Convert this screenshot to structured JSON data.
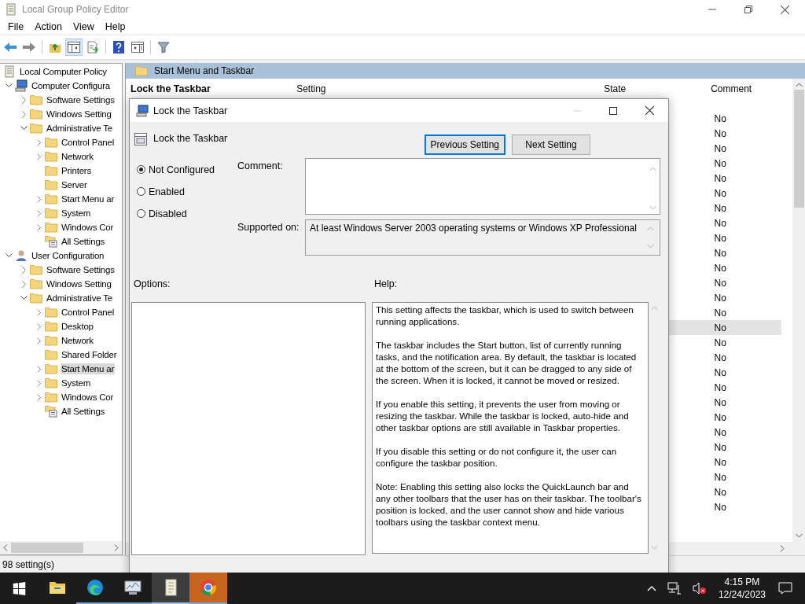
{
  "window": {
    "title": "Local Group Policy Editor"
  },
  "menu": [
    "File",
    "Action",
    "View",
    "Help"
  ],
  "toolbar": [
    {
      "kind": "back",
      "on": false
    },
    {
      "kind": "forward",
      "on": false
    },
    {
      "kind": "sep"
    },
    {
      "kind": "up",
      "on": false
    },
    {
      "kind": "tree",
      "on": true
    },
    {
      "kind": "export",
      "on": false
    },
    {
      "kind": "sep"
    },
    {
      "kind": "help",
      "on": false
    },
    {
      "kind": "view",
      "on": false
    },
    {
      "kind": "sep"
    },
    {
      "kind": "filter",
      "on": false
    }
  ],
  "tree": {
    "label": "Local Computer Policy",
    "kind": "doc",
    "selected": false,
    "children": [
      {
        "label": "Computer Configura",
        "kind": "computer",
        "expanded": true,
        "selected": false,
        "children": [
          {
            "label": "Software Settings",
            "kind": "folder",
            "expanded": false,
            "selected": false
          },
          {
            "label": "Windows Setting",
            "kind": "folder",
            "expanded": false,
            "selected": false
          },
          {
            "label": "Administrative Te",
            "kind": "folder",
            "expanded": true,
            "selected": false,
            "children": [
              {
                "label": "Control Panel",
                "kind": "folder",
                "expanded": false,
                "selected": false
              },
              {
                "label": "Network",
                "kind": "folder",
                "expanded": false,
                "selected": false
              },
              {
                "label": "Printers",
                "kind": "folder",
                "selected": false
              },
              {
                "label": "Server",
                "kind": "folder",
                "selected": false
              },
              {
                "label": "Start Menu ar",
                "kind": "folder",
                "expanded": false,
                "selected": false
              },
              {
                "label": "System",
                "kind": "folder",
                "expanded": false,
                "selected": false
              },
              {
                "label": "Windows Cor",
                "kind": "folder",
                "expanded": false,
                "selected": false
              },
              {
                "label": "All Settings",
                "kind": "settings",
                "selected": false
              }
            ]
          }
        ]
      },
      {
        "label": "User Configuration",
        "kind": "user",
        "expanded": true,
        "selected": false,
        "children": [
          {
            "label": "Software Settings",
            "kind": "folder",
            "expanded": false,
            "selected": false
          },
          {
            "label": "Windows Setting",
            "kind": "folder",
            "expanded": false,
            "selected": false
          },
          {
            "label": "Administrative Te",
            "kind": "folder",
            "expanded": true,
            "selected": false,
            "children": [
              {
                "label": "Control Panel",
                "kind": "folder",
                "expanded": false,
                "selected": false
              },
              {
                "label": "Desktop",
                "kind": "folder",
                "expanded": false,
                "selected": false
              },
              {
                "label": "Network",
                "kind": "folder",
                "expanded": false,
                "selected": false
              },
              {
                "label": "Shared Folder",
                "kind": "folder",
                "selected": false
              },
              {
                "label": "Start Menu ar",
                "kind": "folder",
                "expanded": false,
                "selected": true
              },
              {
                "label": "System",
                "kind": "folder",
                "expanded": false,
                "selected": false
              },
              {
                "label": "Windows Cor",
                "kind": "folder",
                "expanded": false,
                "selected": false
              },
              {
                "label": "All Settings",
                "kind": "settings",
                "selected": false
              }
            ]
          }
        ]
      }
    ]
  },
  "content": {
    "folder": "Start Menu and Taskbar",
    "description_title": "Lock the Taskbar",
    "columns": [
      "Setting",
      "State",
      "Comment"
    ],
    "rows": [
      {
        "comment": "No",
        "selected": false
      },
      {
        "comment": "No",
        "selected": false
      },
      {
        "comment": "No",
        "selected": false
      },
      {
        "comment": "No",
        "selected": false
      },
      {
        "comment": "No",
        "selected": false
      },
      {
        "comment": "No",
        "selected": false
      },
      {
        "comment": "No",
        "selected": false
      },
      {
        "comment": "No",
        "selected": false
      },
      {
        "comment": "No",
        "selected": false
      },
      {
        "comment": "No",
        "selected": false
      },
      {
        "comment": "No",
        "selected": false
      },
      {
        "comment": "No",
        "selected": false
      },
      {
        "comment": "No",
        "selected": false
      },
      {
        "comment": "No",
        "selected": false
      },
      {
        "comment": "No",
        "selected": true
      },
      {
        "comment": "No",
        "selected": false
      },
      {
        "comment": "No",
        "selected": false
      },
      {
        "comment": "No",
        "selected": false
      },
      {
        "comment": "No",
        "selected": false
      },
      {
        "comment": "No",
        "selected": false
      },
      {
        "comment": "No",
        "selected": false
      },
      {
        "comment": "No",
        "selected": false
      },
      {
        "comment": "No",
        "selected": false
      },
      {
        "comment": "No",
        "selected": false
      },
      {
        "comment": "No",
        "selected": false
      },
      {
        "comment": "No",
        "selected": false
      },
      {
        "comment": "No",
        "selected": false
      }
    ]
  },
  "status_bar": "98 setting(s)",
  "dialog": {
    "title": "Lock the Taskbar",
    "setting_name": "Lock the Taskbar",
    "buttons": [
      {
        "label": "Previous Setting",
        "focused": true
      },
      {
        "label": "Next Setting",
        "focused": false
      }
    ],
    "options": [
      {
        "label": "Not Configured",
        "selected": true
      },
      {
        "label": "Enabled",
        "selected": false
      },
      {
        "label": "Disabled",
        "selected": false
      }
    ],
    "comment_label": "Comment:",
    "supported_label": "Supported on:",
    "supported_on": "At least Windows Server 2003 operating systems or Windows XP Professional",
    "options_label": "Options:",
    "help_label": "Help:",
    "help": [
      "This setting affects the taskbar, which is used to switch between running applications.",
      "The taskbar includes the Start button, list of currently running tasks, and the notification area. By default, the taskbar is located at the bottom of the screen, but it can be dragged to any side of the screen. When it is locked, it cannot be moved or resized.",
      "If you enable this setting, it prevents the user from moving or resizing the taskbar. While the taskbar is locked, auto-hide and other taskbar options are still available in Taskbar properties.",
      "If you disable this setting or do not configure it, the user can configure the taskbar position.",
      "Note: Enabling this setting also locks the QuickLaunch bar and any other toolbars that the user has on their taskbar. The toolbar's position is locked, and the user cannot show and hide various toolbars using the taskbar context menu."
    ]
  },
  "taskbar": {
    "apps": [
      {
        "kind": "explorer",
        "running": false,
        "selected": false,
        "flashing": false
      },
      {
        "kind": "edge",
        "running": true,
        "selected": false,
        "flashing": false
      },
      {
        "kind": "monitor",
        "running": true,
        "selected": false,
        "flashing": false
      },
      {
        "kind": "policy",
        "running": true,
        "selected": true,
        "flashing": false
      },
      {
        "kind": "chrome",
        "running": true,
        "selected": false,
        "flashing": true
      }
    ],
    "time": "4:15 PM",
    "date": "12/24/2023"
  }
}
